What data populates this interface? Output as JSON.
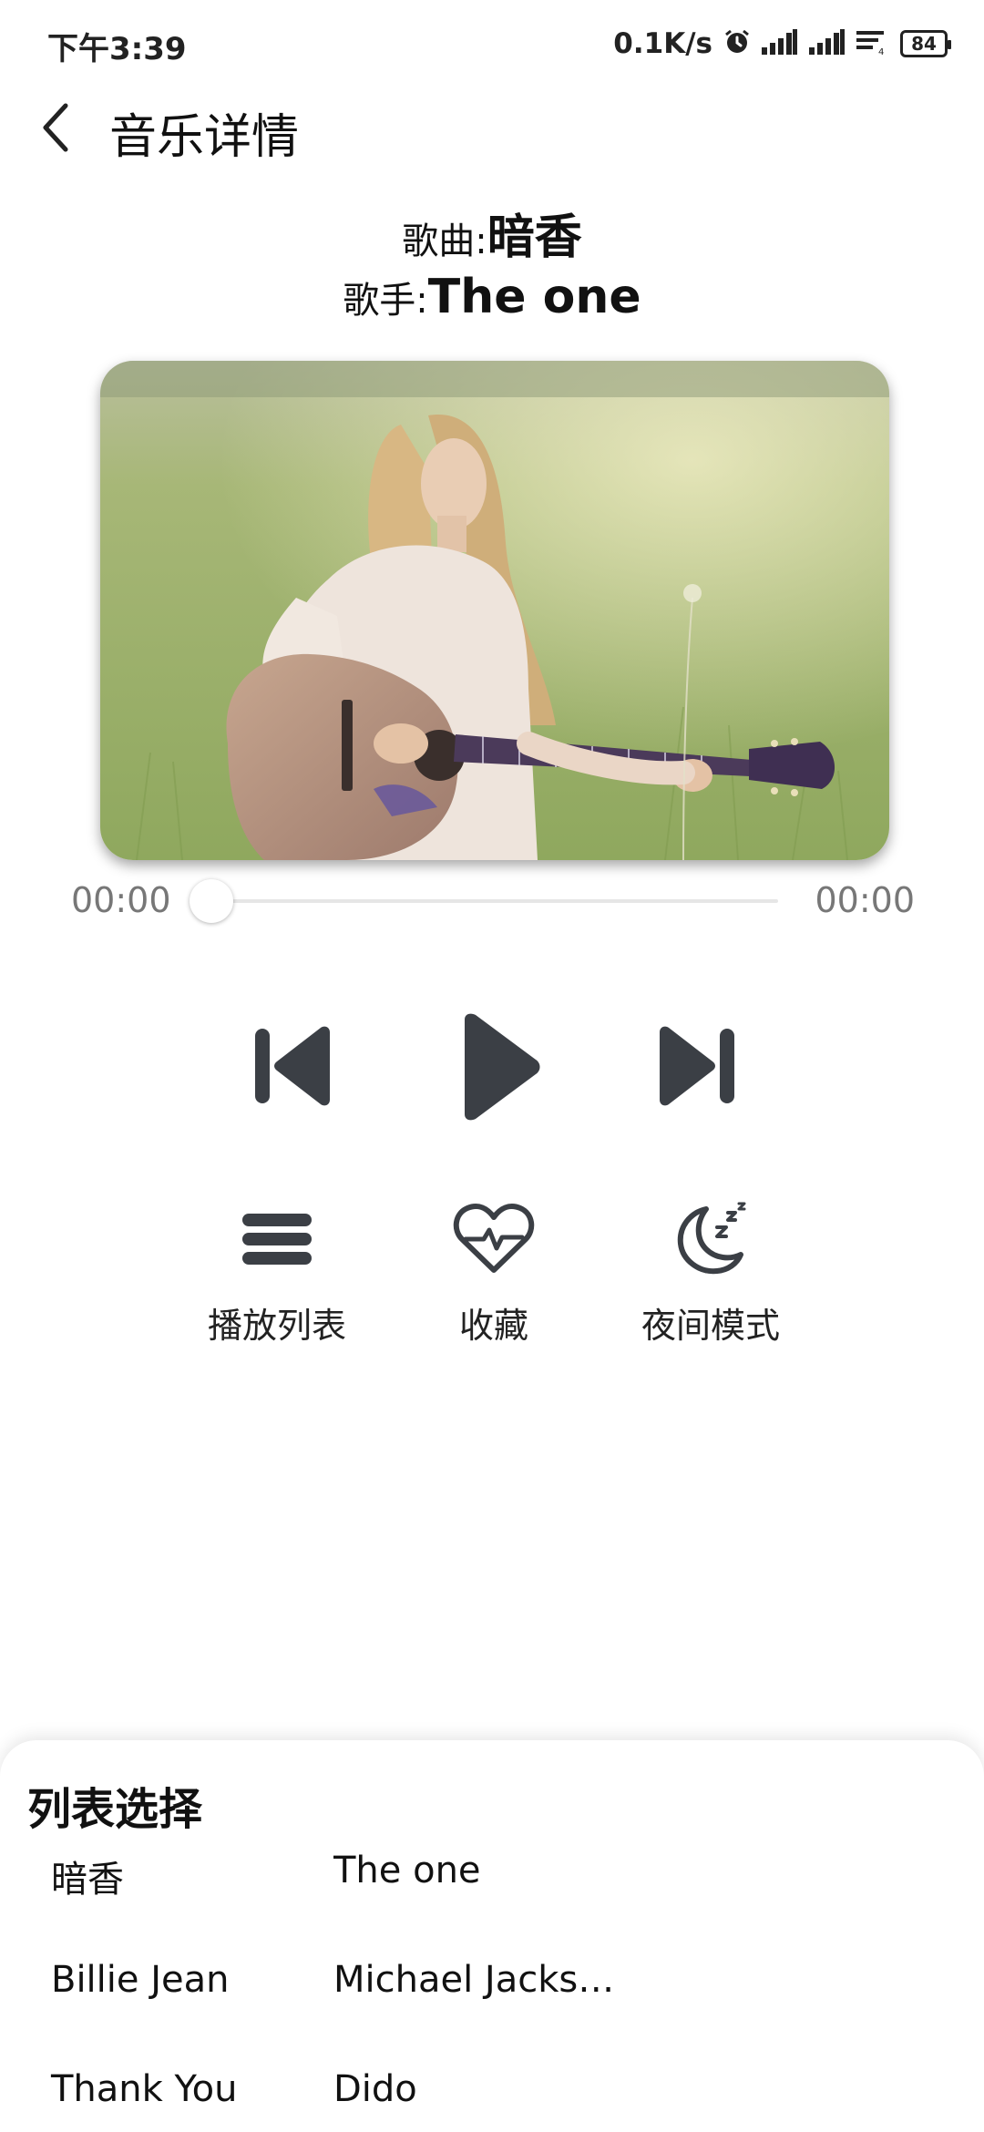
{
  "status_bar": {
    "time": "下午3:39",
    "net_speed": "0.1K/s",
    "battery": "84",
    "icons": [
      "alarm-icon",
      "signal-icon",
      "signal-icon",
      "wifi-icon",
      "battery-icon"
    ]
  },
  "header": {
    "title": "音乐详情",
    "back_icon": "chevron-left-icon"
  },
  "song": {
    "title_label": "歌曲:",
    "title": "暗香",
    "artist_label": "歌手:",
    "artist": "The one"
  },
  "album_art": {
    "description_icon": "album-cover"
  },
  "progress": {
    "current": "00:00",
    "total": "00:00",
    "fraction": 0
  },
  "controls": {
    "previous_icon": "skip-previous-icon",
    "play_icon": "play-icon",
    "next_icon": "skip-next-icon"
  },
  "actions": [
    {
      "label": "播放列表",
      "icon": "list-icon"
    },
    {
      "label": "收藏",
      "icon": "heart-pulse-icon"
    },
    {
      "label": "夜间模式",
      "icon": "moon-sleep-icon"
    }
  ],
  "playlist_sheet": {
    "title": "列表选择",
    "rows": [
      {
        "name": "暗香",
        "artist": "The one"
      },
      {
        "name": "Billie Jean",
        "artist": "Michael Jacks…"
      },
      {
        "name": "Thank You",
        "artist": "Dido"
      }
    ]
  },
  "colors": {
    "icon_dark": "#3b3f45",
    "text_primary": "#111111",
    "text_secondary": "#777777",
    "track": "#e6e6e6",
    "background": "#ffffff"
  }
}
